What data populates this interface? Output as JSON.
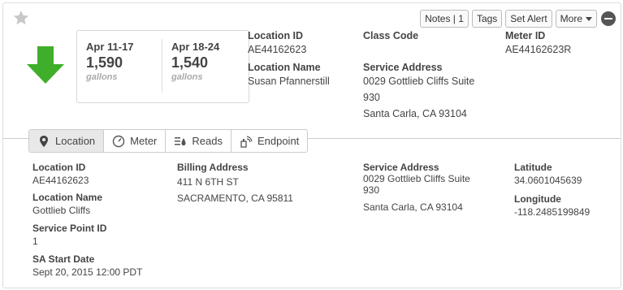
{
  "toolbar": {
    "notes_label": "Notes | 1",
    "tags_label": "Tags",
    "set_alert_label": "Set Alert",
    "more_label": "More"
  },
  "usage": {
    "period1": "Apr 11-17",
    "amount1": "1,590",
    "unit1": "gallons",
    "period2": "Apr 18-24",
    "amount2": "1,540",
    "unit2": "gallons"
  },
  "summary": {
    "location_id_label": "Location ID",
    "location_id": "AE44162623",
    "location_name_label": "Location Name",
    "location_name": "Susan Pfannerstill",
    "class_code_label": "Class Code",
    "class_code": "",
    "service_address_label": "Service Address",
    "service_address_line1": "0029 Gottlieb Cliffs Suite",
    "service_address_line2": "930",
    "service_address_line3": "Santa Carla, CA 93104",
    "meter_id_label": "Meter ID",
    "meter_id": "AE44162623R"
  },
  "tabs": [
    {
      "label": "Location",
      "icon": "map-pin-icon"
    },
    {
      "label": "Meter",
      "icon": "gauge-icon"
    },
    {
      "label": "Reads",
      "icon": "reads-icon"
    },
    {
      "label": "Endpoint",
      "icon": "endpoint-icon"
    }
  ],
  "details": {
    "location_id_label": "Location ID",
    "location_id": "AE44162623",
    "location_name_label": "Location Name",
    "location_name": "Gottlieb Cliffs",
    "service_point_id_label": "Service Point ID",
    "service_point_id": "1",
    "sa_start_date_label": "SA Start Date",
    "sa_start_date": "Sept 20, 2015 12:00 PDT",
    "billing_address_label": "Billing Address",
    "billing_address_line1": "411 N 6TH ST",
    "billing_address_line2": "SACRAMENTO, CA 95811",
    "service_address_label": "Service Address",
    "service_address_line1": "0029 Gottlieb Cliffs Suite",
    "service_address_line2": "930",
    "service_address_line3": "Santa Carla, CA 93104",
    "latitude_label": "Latitude",
    "latitude": "34.0601045639",
    "longitude_label": "Longitude",
    "longitude": "-118.2485199849"
  },
  "colors": {
    "trend_arrow": "#3fae2a",
    "active_tab_bg": "#e8e8e8"
  }
}
